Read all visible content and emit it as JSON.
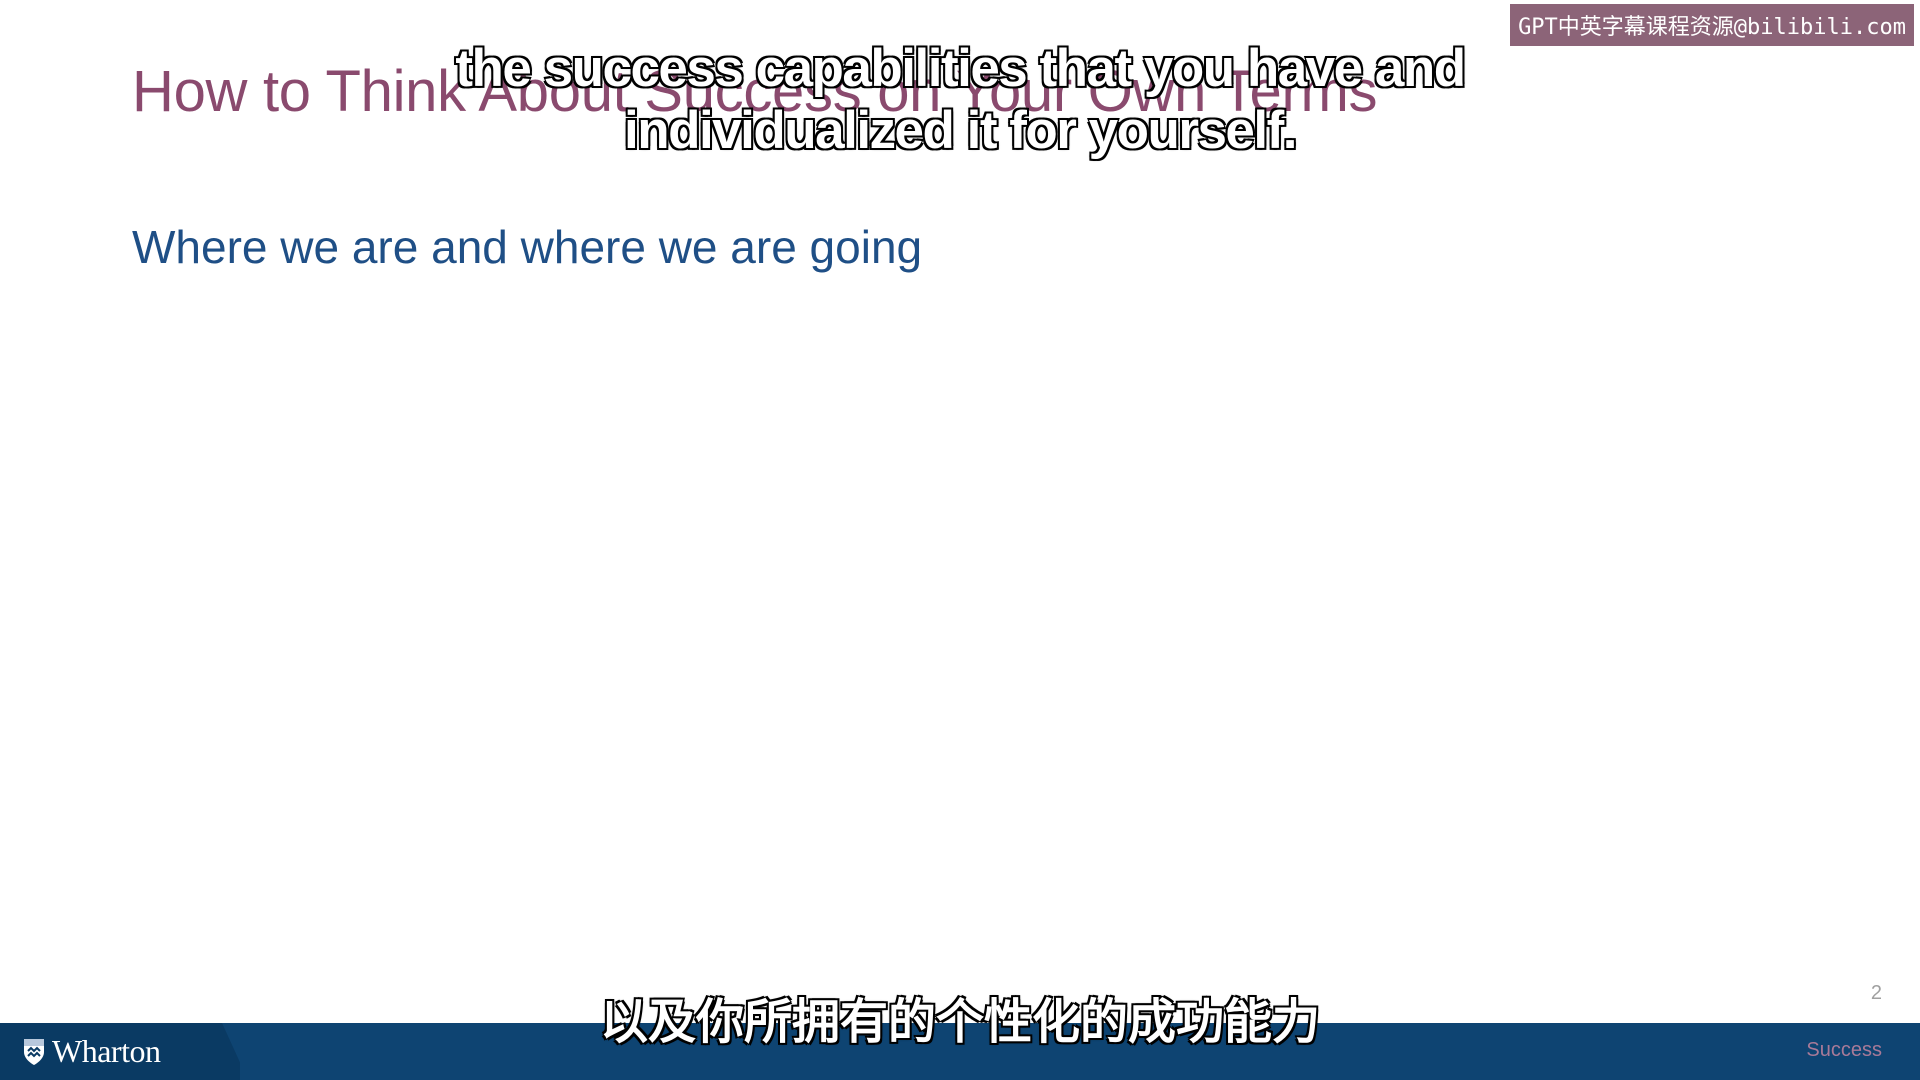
{
  "slide": {
    "title": "How to Think About Success on Your Own Terms",
    "subtitle": "Where we are and where we are going",
    "page_number": "2"
  },
  "captions": {
    "english_line1": "the success capabilities that you have and",
    "english_line2": "individualized it for yourself.",
    "chinese": "以及你所拥有的个性化的成功能力"
  },
  "watermark": "GPT中英字幕课程资源@bilibili.com",
  "footer": {
    "logo_text": "Wharton",
    "logo_icon": "shield-icon",
    "label": "Success"
  },
  "colors": {
    "title": "#8a4a6e",
    "subtitle": "#1f4f86",
    "footer_bar": "#0e4472",
    "watermark_bg": "#8c6478"
  }
}
